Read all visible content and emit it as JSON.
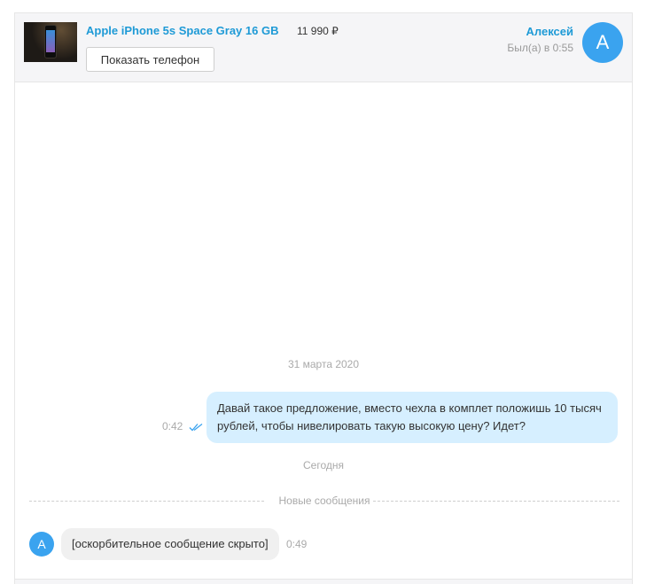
{
  "listing": {
    "title": "Apple iPhone 5s Space Gray 16 GB",
    "price": "11 990 ₽",
    "show_phone_label": "Показать телефон",
    "thumbnail_icon": "phone-photo-thumbnail"
  },
  "contact": {
    "name": "Алексей",
    "last_seen": "Был(а) в 0:55",
    "avatar_letter": "А"
  },
  "colors": {
    "accent": "#1e9ad6",
    "avatar": "#3aa3ef",
    "outgoing_bubble": "#d6efff",
    "incoming_bubble": "#f0f0f0",
    "read_check": "#3aa3ef"
  },
  "chat": {
    "date_older": "31 марта 2020",
    "outgoing": {
      "text": "Давай такое предложение, вместо чехла в комплет положишь 10 тысяч рублей, чтобы нивелировать такую высокую цену? Идет?",
      "time": "0:42",
      "status_icon": "double-check-icon"
    },
    "date_today": "Сегодня",
    "new_messages_label": "Новые сообщения",
    "incoming": {
      "avatar_letter": "А",
      "text": "[оскорбительное сообщение скрыто]",
      "time": "0:49"
    }
  }
}
